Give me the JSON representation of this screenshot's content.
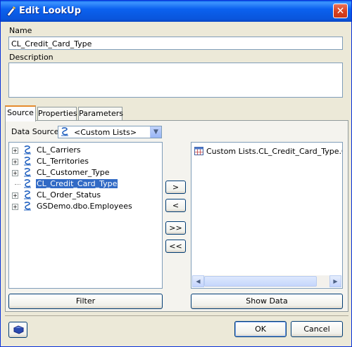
{
  "window": {
    "title": "Edit LookUp",
    "close_glyph": "✕"
  },
  "name": {
    "label": "Name",
    "value": "CL_Credit_Card_Type"
  },
  "description": {
    "label": "Description",
    "value": ""
  },
  "tabs": [
    {
      "label": "Source",
      "active": true
    },
    {
      "label": "Properties"
    },
    {
      "label": "Parameters"
    }
  ],
  "data_source": {
    "label": "Data Source",
    "value": "<Custom Lists>"
  },
  "tree": {
    "items": [
      {
        "label": "CL_Carriers",
        "expandable": true
      },
      {
        "label": "CL_Territories",
        "expandable": true
      },
      {
        "label": "CL_Customer_Type",
        "expandable": true
      },
      {
        "label": "CL_Credit_Card_Type",
        "expandable": false,
        "selected": true
      },
      {
        "label": "CL_Order_Status",
        "expandable": true
      },
      {
        "label": "GSDemo.dbo.Employees",
        "expandable": true
      }
    ]
  },
  "transfer": {
    "add": ">",
    "remove": "<",
    "add_all": ">>",
    "remove_all": "<<"
  },
  "selected_list": {
    "items": [
      "Custom Lists.CL_Credit_Card_Type.Credi"
    ]
  },
  "buttons": {
    "filter": "Filter",
    "show_data": "Show Data",
    "ok": "OK",
    "cancel": "Cancel"
  },
  "colors": {
    "title_bar": "#0a55db",
    "selection": "#316ac5",
    "tab_highlight": "#e68b2c"
  }
}
